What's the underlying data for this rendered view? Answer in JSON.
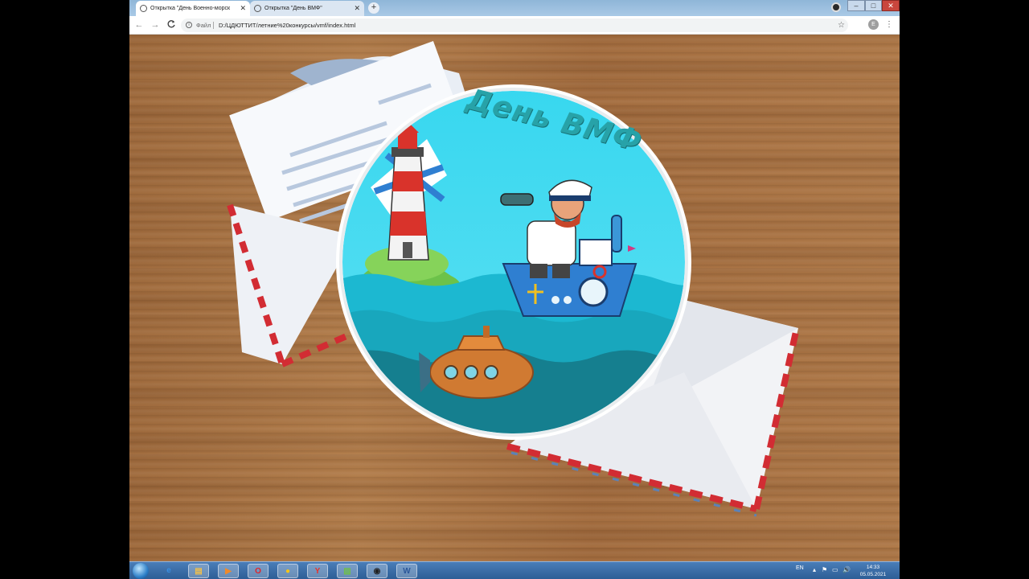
{
  "browser": {
    "tabs": [
      {
        "title": "Открытка \"День Военно-морск",
        "active": true
      },
      {
        "title": "Открытка \"День ВМФ\"",
        "active": false
      }
    ],
    "new_tab_label": "+",
    "controls": {
      "minimize": "–",
      "maximize": "□",
      "close": "✕"
    },
    "nav": {
      "back": "←",
      "forward": "→",
      "reload": "C"
    },
    "address": {
      "scheme_label": "Файл",
      "url": "D:/ЦДЮТТИТ/летние%20конкурсы/vmf/index.html",
      "info_icon": "i"
    },
    "bookmark_icon": "star-icon",
    "profile_initial": "E",
    "menu_icon": "kebab-menu-icon"
  },
  "page": {
    "card_title": "День ВМФ"
  },
  "taskbar": {
    "apps": [
      {
        "name": "internet-explorer",
        "glyph": "e",
        "color": "#3a8fe0"
      },
      {
        "name": "file-explorer",
        "glyph": "▤",
        "color": "#f2c04a"
      },
      {
        "name": "media-player",
        "glyph": "▶",
        "color": "#f08a2a"
      },
      {
        "name": "opera",
        "glyph": "O",
        "color": "#e0242a"
      },
      {
        "name": "chrome",
        "glyph": "●",
        "color": "#f5c518"
      },
      {
        "name": "yandex-browser",
        "glyph": "Y",
        "color": "#e8312a"
      },
      {
        "name": "image-app",
        "glyph": "▨",
        "color": "#6fbf4a"
      },
      {
        "name": "obs",
        "glyph": "◉",
        "color": "#222"
      },
      {
        "name": "word",
        "glyph": "W",
        "color": "#2b579a"
      }
    ],
    "language": "EN",
    "tray_glyphs": [
      "▴",
      "⚑",
      "▭",
      "🔊"
    ],
    "time": "14:33",
    "date": "05.05.2021"
  }
}
